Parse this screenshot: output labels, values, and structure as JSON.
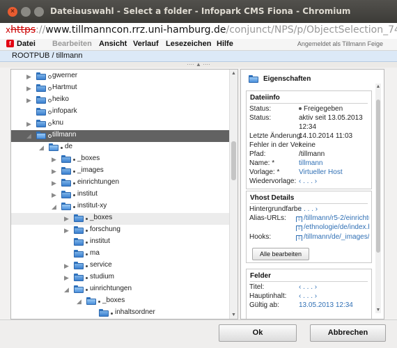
{
  "window": {
    "title": "Dateiauswahl - Select a folder - Infopark CMS Fiona - Chromium",
    "close_glyph": "×",
    "min_glyph": "",
    "max_glyph": ""
  },
  "urlbar": {
    "insecure_mark": "x",
    "protocol": "https",
    "separator": "://",
    "host": "www.tillmanncon.rrz.uni-hamburg.de",
    "path": "/conjunct/NPS/p/ObjectSelection_74"
  },
  "menu": {
    "brand": "f",
    "items": [
      "Datei",
      "Bearbeiten",
      "Ansicht",
      "Verlauf",
      "Lesezeichen",
      "Hilfe"
    ],
    "logged_in": "Angemeldet als Tillmann Feige"
  },
  "breadcrumb": "ROOTPUB / tillmann",
  "tree": {
    "rows": [
      {
        "label": "gwerner",
        "level": 0,
        "state": "collapsed",
        "dot": "ring"
      },
      {
        "label": "Hartmut",
        "level": 0,
        "state": "collapsed",
        "dot": "ring"
      },
      {
        "label": "heiko",
        "level": 0,
        "state": "collapsed",
        "dot": "ring"
      },
      {
        "label": "infopark",
        "level": 0,
        "state": "none",
        "dot": "ring"
      },
      {
        "label": "knu",
        "level": 0,
        "state": "collapsed",
        "dot": "ring"
      },
      {
        "label": "tillmann",
        "level": 0,
        "state": "expanded",
        "dot": "ring",
        "selected": true
      },
      {
        "label": "de",
        "level": 1,
        "state": "expanded",
        "dot": "fill"
      },
      {
        "label": "_boxes",
        "level": 2,
        "state": "collapsed",
        "dot": "fill"
      },
      {
        "label": "_images",
        "level": 2,
        "state": "collapsed",
        "dot": "fill"
      },
      {
        "label": "einrichtungen",
        "level": 2,
        "state": "collapsed",
        "dot": "fill"
      },
      {
        "label": "institut",
        "level": 2,
        "state": "collapsed",
        "dot": "fill"
      },
      {
        "label": "institut-xy",
        "level": 2,
        "state": "expanded",
        "dot": "fill"
      },
      {
        "label": "_boxes",
        "level": 3,
        "state": "collapsed",
        "dot": "fill",
        "highlight": true
      },
      {
        "label": "forschung",
        "level": 3,
        "state": "collapsed",
        "dot": "fill"
      },
      {
        "label": "institut",
        "level": 3,
        "state": "none",
        "dot": "fill"
      },
      {
        "label": "ma",
        "level": 3,
        "state": "none",
        "dot": "fill"
      },
      {
        "label": "service",
        "level": 3,
        "state": "collapsed",
        "dot": "fill"
      },
      {
        "label": "studium",
        "level": 3,
        "state": "collapsed",
        "dot": "fill"
      },
      {
        "label": "uinrichtungen",
        "level": 3,
        "state": "expanded",
        "dot": "fill"
      },
      {
        "label": "_boxes",
        "level": 4,
        "state": "expanded",
        "dot": "fill"
      },
      {
        "label": "inhaltsordner",
        "level": 5,
        "state": "none",
        "dot": "fill"
      }
    ]
  },
  "properties": {
    "title": "Eigenschaften",
    "dateiinfo": {
      "heading": "Dateiinfo",
      "rows": [
        {
          "label": "Status:",
          "value": "Freigegeben",
          "bullet": true
        },
        {
          "label": "Status:",
          "value": "aktiv seit 13.05.2013"
        },
        {
          "label": "",
          "value": "12:34"
        },
        {
          "label": "Letzte Änderung:",
          "value": "14.10.2014 11:03"
        },
        {
          "label": "Fehler in der Ver",
          "value": "keine"
        },
        {
          "label": "Pfad:",
          "value": "/tillmann"
        },
        {
          "label": "Name: *",
          "value": "tillmann",
          "link": true
        },
        {
          "label": "Vorlage: *",
          "value": "Virtueller Host",
          "link": true
        },
        {
          "label": "Wiedervorlage:",
          "value": "‹ . . . ›",
          "link": true
        }
      ]
    },
    "vhost": {
      "heading": "Vhost Details",
      "rows": [
        {
          "label": "Hintergrundfarbe",
          "value": "‹ . . . ›"
        },
        {
          "label": "Alias-URLs:",
          "value": "/tillmann/r5-2/einrichtu"
        },
        {
          "label": "",
          "value": "/ethnologie/de/index.h"
        },
        {
          "label": "Hooks:",
          "value": "/tillmann/de/_images/"
        }
      ],
      "button": "Alle bearbeiten"
    },
    "felder": {
      "heading": "Felder",
      "rows": [
        {
          "label": "Titel:",
          "value": "‹ . . . ›"
        },
        {
          "label": "Hauptinhalt:",
          "value": "‹ . . . ›"
        },
        {
          "label": "Gültig ab:",
          "value": "13.05.2013 12:34"
        }
      ]
    }
  },
  "buttons": {
    "ok": "Ok",
    "cancel": "Abbrechen"
  }
}
